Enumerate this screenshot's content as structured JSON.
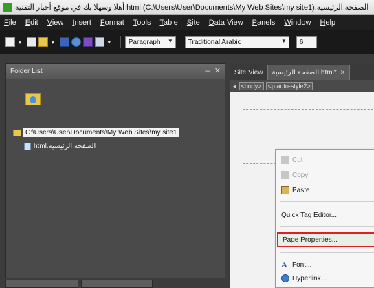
{
  "window": {
    "title": "الصفحة الرئيسية.html (C:\\Users\\User\\Documents\\My Web Sites\\my site1) أهلا وسهلا بك في موقع أخبار التقنية"
  },
  "menu": [
    {
      "u": "F",
      "rest": "ile"
    },
    {
      "u": "E",
      "rest": "dit"
    },
    {
      "u": "V",
      "rest": "iew"
    },
    {
      "u": "I",
      "rest": "nsert"
    },
    {
      "u": "F",
      "rest": "ormat"
    },
    {
      "u": "T",
      "rest": "ools"
    },
    {
      "u": "T",
      "rest": "able"
    },
    {
      "u": "S",
      "rest": "ite"
    },
    {
      "u": "D",
      "rest": "ata View"
    },
    {
      "u": "P",
      "rest": "anels"
    },
    {
      "u": "W",
      "rest": "indow"
    },
    {
      "u": "H",
      "rest": "elp"
    }
  ],
  "toolbar": {
    "style_select": "Paragraph",
    "font_select": "Traditional Arabic",
    "size_select": "6"
  },
  "folder_list": {
    "title": "Folder List",
    "root_path": "C:\\Users\\User\\Documents\\My Web Sites\\my site1",
    "file_name": "الصفحة الرئيسية.html"
  },
  "editor": {
    "tab_site_view": "Site View",
    "tab_page": "الصفحة الرئيسية.html*",
    "tag_body": "<body>",
    "tag_p": "<p.auto-style2>"
  },
  "context_menu": {
    "cut": "Cut",
    "copy": "Copy",
    "paste": "Paste",
    "quick_tag_editor": "Quick Tag Editor...",
    "page_properties": "Page Properties...",
    "font": "Font...",
    "hyperlink": "Hyperlink..."
  },
  "colors": {
    "highlight_border": "#e02020",
    "menubar_bg": "#1f1f1f",
    "panel_bg": "#4a4a4a"
  }
}
